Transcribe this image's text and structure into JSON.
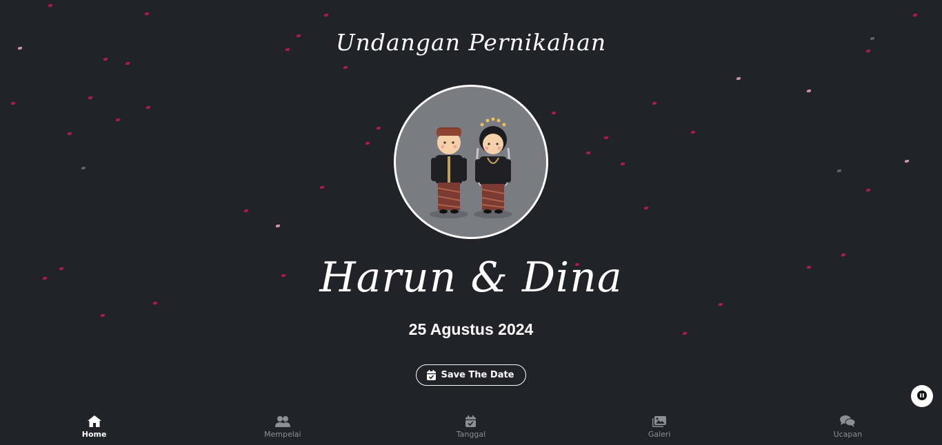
{
  "hero": {
    "title": "Undangan Pernikahan",
    "names": "Harun & Dina",
    "date": "25 Agustus 2024",
    "save_button_label": "Save The Date",
    "save_button_icon": "calendar-check-icon",
    "image": "couple-illustration"
  },
  "music_toggle": {
    "icon": "pause-icon"
  },
  "bottom_nav": {
    "items": [
      {
        "label": "Home",
        "icon": "home-icon",
        "active": true
      },
      {
        "label": "Mempelai",
        "icon": "users-icon",
        "active": false
      },
      {
        "label": "Tanggal",
        "icon": "calendar-check-icon",
        "active": false
      },
      {
        "label": "Galeri",
        "icon": "images-icon",
        "active": false
      },
      {
        "label": "Ucapan",
        "icon": "comments-icon",
        "active": false
      }
    ]
  },
  "colors": {
    "background": "#212329",
    "text": "#ffffff",
    "nav_inactive": "#8e8f94",
    "petal": "#c2185b",
    "avatar_bg": "#7b7c82"
  }
}
